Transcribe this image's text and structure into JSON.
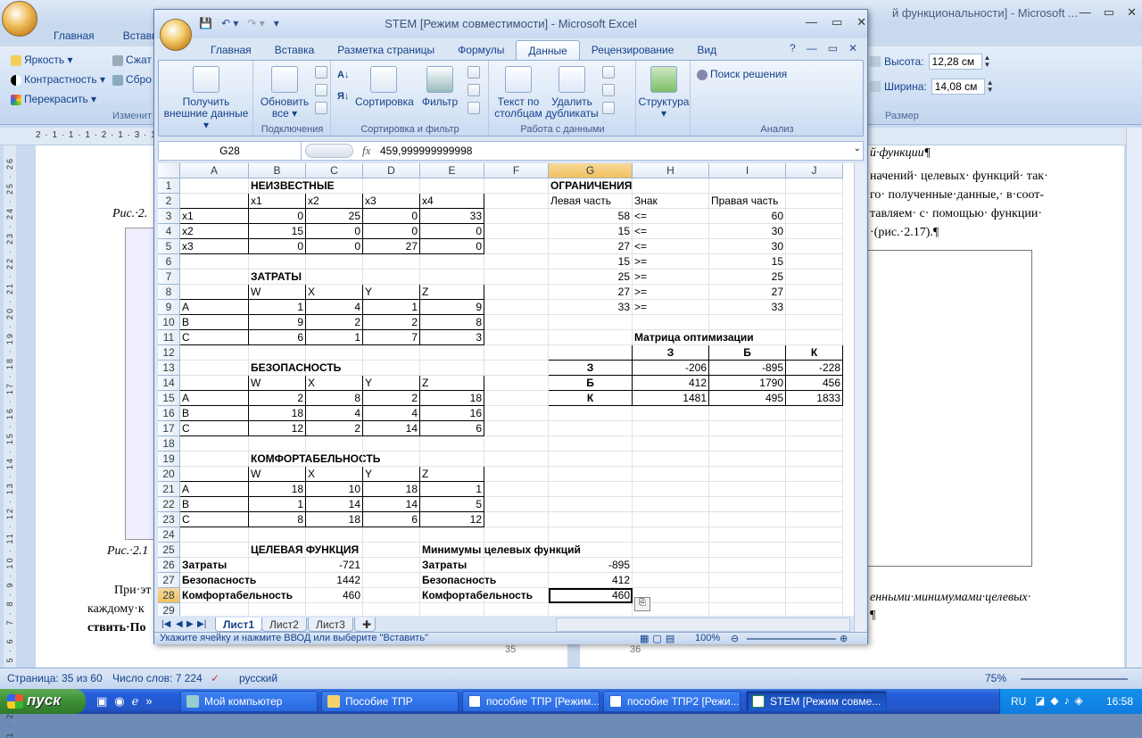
{
  "word": {
    "title": "й функциональности] - Microsoft ...",
    "tabs": [
      "Главная",
      "Вставка"
    ],
    "ribbon": {
      "brightness": "Яркость",
      "contrast": "Контрастность",
      "recolor": "Перекрасить",
      "compress": "Сжат",
      "reset": "Сбро",
      "group_change": "Изменит",
      "height_label": "Высота:",
      "height_value": "12,28 см",
      "width_label": "Ширина:",
      "width_value": "14,08 см",
      "group_size": "Размер"
    },
    "ruler": "2 · 1 · 1 · 1 · 2 · 1 · 3 · 1 · 4 · 1 · 5 · 1 · 6 · 1 · 7 · 1 · 8",
    "page_left": {
      "caption_top": "Рис.·2.",
      "caption_bottom": "Рис.·2.1",
      "para_line1": "При·эт",
      "para_line2": "каждому·к",
      "para_line3": "ствить·По",
      "page_num": "35"
    },
    "page_right": {
      "line0": "й·функции¶",
      "line1": "начений· целевых· функций· так·",
      "line2": "го· полученные·данные,· в·соот-",
      "line3": "тавляем· с· помощью· функции·",
      "line4": "·(рис.·2.17).¶",
      "line5": "енными·минимумами·целевых·",
      "line6": "¶",
      "page_num": "36"
    },
    "status": {
      "page": "Страница: 35 из 60",
      "words": "Число слов: 7 224",
      "lang": "русский",
      "zoom": "75%"
    }
  },
  "taskbar": {
    "start": "пуск",
    "buttons": [
      "Мой компьютер",
      "Пособие ТПР",
      "пособие ТПР [Режим...",
      "пособие ТПР2 [Режи...",
      "STEM  [Режим совме..."
    ],
    "lang": "RU",
    "time": "16:58"
  },
  "excel": {
    "title": "STEM  [Режим совместимости] - Microsoft Excel",
    "tabs": [
      "Главная",
      "Вставка",
      "Разметка страницы",
      "Формулы",
      "Данные",
      "Рецензирование",
      "Вид"
    ],
    "active_tab": "Данные",
    "ribbon": {
      "get_external": "Получить\nвнешние данные",
      "refresh_all": "Обновить\nвсе",
      "group_connections": "Подключения",
      "sort": "Сортировка",
      "filter": "Фильтр",
      "group_sort_filter": "Сортировка и фильтр",
      "text_to_columns": "Текст по\nстолбцам",
      "remove_duplicates": "Удалить\nдубликаты",
      "group_data_tools": "Работа с данными",
      "structure": "Структура",
      "solver": "Поиск решения",
      "group_analysis": "Анализ"
    },
    "namebox": "G28",
    "formula": "459,999999999998",
    "columns": [
      "A",
      "B",
      "C",
      "D",
      "E",
      "F",
      "G",
      "H",
      "I",
      "J"
    ],
    "rows": [
      [
        "",
        "НЕИЗВЕСТНЫЕ",
        "",
        "",
        "",
        "",
        "ОГРАНИЧЕНИЯ",
        "",
        "",
        ""
      ],
      [
        "",
        "x1",
        "x2",
        "x3",
        "x4",
        "",
        "Левая часть",
        "Знак",
        "Правая часть",
        ""
      ],
      [
        "x1",
        "0",
        "25",
        "0",
        "33",
        "",
        "58",
        "<=",
        "60",
        ""
      ],
      [
        "x2",
        "15",
        "0",
        "0",
        "0",
        "",
        "15",
        "<=",
        "30",
        ""
      ],
      [
        "x3",
        "0",
        "0",
        "27",
        "0",
        "",
        "27",
        "<=",
        "30",
        ""
      ],
      [
        "",
        "",
        "",
        "",
        "",
        "",
        "15",
        ">=",
        "15",
        ""
      ],
      [
        "",
        "ЗАТРАТЫ",
        "",
        "",
        "",
        "",
        "25",
        ">=",
        "25",
        ""
      ],
      [
        "",
        "W",
        "X",
        "Y",
        "Z",
        "",
        "27",
        ">=",
        "27",
        ""
      ],
      [
        "A",
        "1",
        "4",
        "1",
        "9",
        "",
        "33",
        ">=",
        "33",
        ""
      ],
      [
        "B",
        "9",
        "2",
        "2",
        "8",
        "",
        "",
        "",
        "",
        ""
      ],
      [
        "C",
        "6",
        "1",
        "7",
        "3",
        "",
        "",
        "Матрица оптимизации",
        "",
        ""
      ],
      [
        "",
        "",
        "",
        "",
        "",
        "",
        "",
        "З",
        "Б",
        "К"
      ],
      [
        "",
        "БЕЗОПАСНОСТЬ",
        "",
        "",
        "",
        "",
        "З",
        "-206",
        "-895",
        "-228"
      ],
      [
        "",
        "W",
        "X",
        "Y",
        "Z",
        "",
        "Б",
        "412",
        "1790",
        "456"
      ],
      [
        "A",
        "2",
        "8",
        "2",
        "18",
        "",
        "К",
        "1481",
        "495",
        "1833"
      ],
      [
        "B",
        "18",
        "4",
        "4",
        "16",
        "",
        "",
        "",
        "",
        ""
      ],
      [
        "C",
        "12",
        "2",
        "14",
        "6",
        "",
        "",
        "",
        "",
        ""
      ],
      [
        "",
        "",
        "",
        "",
        "",
        "",
        "",
        "",
        "",
        ""
      ],
      [
        "",
        "КОМФОРТАБЕЛЬНОСТЬ",
        "",
        "",
        "",
        "",
        "",
        "",
        "",
        ""
      ],
      [
        "",
        "W",
        "X",
        "Y",
        "Z",
        "",
        "",
        "",
        "",
        ""
      ],
      [
        "A",
        "18",
        "10",
        "18",
        "1",
        "",
        "",
        "",
        "",
        ""
      ],
      [
        "B",
        "1",
        "14",
        "14",
        "5",
        "",
        "",
        "",
        "",
        ""
      ],
      [
        "C",
        "8",
        "18",
        "6",
        "12",
        "",
        "",
        "",
        "",
        ""
      ],
      [
        "",
        "",
        "",
        "",
        "",
        "",
        "",
        "",
        "",
        ""
      ],
      [
        "",
        "ЦЕЛЕВАЯ ФУНКЦИЯ",
        "",
        "",
        "Минимумы целевых  функций",
        "",
        "",
        "",
        "",
        ""
      ],
      [
        "Затраты",
        "",
        "-721",
        "",
        "Затраты",
        "",
        "-895",
        "",
        "",
        ""
      ],
      [
        "Безопасность",
        "",
        "1442",
        "",
        "Безопасность",
        "",
        "412",
        "",
        "",
        ""
      ],
      [
        "Комфортабельность",
        "",
        "460",
        "",
        "Комфортабельность",
        "",
        "460",
        "",
        "",
        ""
      ],
      [
        "",
        "",
        "",
        "",
        "",
        "",
        "",
        "",
        "",
        ""
      ]
    ],
    "sheets": [
      "Лист1",
      "Лист2",
      "Лист3"
    ],
    "status_msg": "Укажите ячейку и нажмите ВВОД или выберите \"Вставить\"",
    "zoom": "100%"
  }
}
